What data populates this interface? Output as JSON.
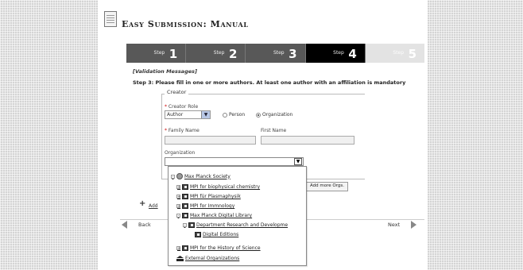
{
  "title": "Easy Submission: Manual",
  "steps": [
    {
      "label": "Step",
      "num": "1"
    },
    {
      "label": "Step",
      "num": "2"
    },
    {
      "label": "Step",
      "num": "3"
    },
    {
      "label": "Step",
      "num": "4"
    },
    {
      "label": "Step",
      "num": "5"
    }
  ],
  "validation": "[Validation Messages]",
  "instruction": "Step 3: Please fill in one or more authors. At least one author with an affiliation is mandatory",
  "creator": {
    "legend": "Creator",
    "role_label": "Creator Role",
    "role_value": "Author",
    "type_person": "Person",
    "type_org": "Organization",
    "family_name_label": "Family Name",
    "first_name_label": "First Name",
    "org_label": "Organization",
    "add_orgs": "Add more Orgs."
  },
  "tree": [
    {
      "label": "Max Planck Society"
    },
    {
      "label": "MPI for biophysical chemistry"
    },
    {
      "label": "MPI für Plasmaphysik"
    },
    {
      "label": "MPI for Immnology"
    },
    {
      "label": "Max Planck Digital Library"
    },
    {
      "label": "Department Research and Developme"
    },
    {
      "label": "Digital Editions"
    },
    {
      "label": "MPI for the History of Science"
    },
    {
      "label": "External Organizations"
    }
  ],
  "add_author": "Add",
  "back": "Back",
  "next": "Next"
}
